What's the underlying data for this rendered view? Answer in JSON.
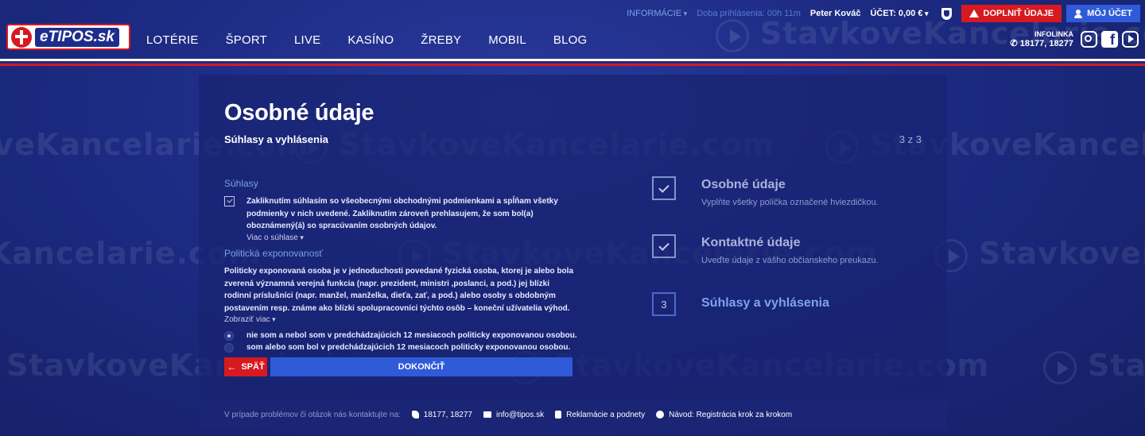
{
  "watermark": {
    "text": "StavkoveKancelarie.com"
  },
  "header": {
    "logo_text": "eTIPOS.sk",
    "nav": [
      "LOTÉRIE",
      "ŠPORT",
      "LIVE",
      "KASÍNO",
      "ŽREBY",
      "MOBIL",
      "BLOG"
    ],
    "info_label": "INFORMÁCIE",
    "login_time": "Doba prihlásenia: 00h 11m",
    "user_name": "Peter Kováč",
    "account_balance": "ÚČET: 0,00 €",
    "fill_button": "DOPLNIŤ ÚDAJE",
    "my_account_button": "MÔJ ÚČET",
    "infolinka_label": "INFOLINKA",
    "infolinka_number": "18177, 18277",
    "socials": [
      "instagram-icon",
      "facebook-icon",
      "youtube-icon"
    ],
    "stripe_colors": [
      "#ffffff",
      "#1c2a82",
      "#d71920"
    ]
  },
  "form": {
    "title": "Osobné údaje",
    "subtitle": "Súhlasy a vyhlásenia",
    "step_counter": "3 z 3",
    "consents_heading": "Súhlasy",
    "consent_text": "Zakliknutím súhlasím so všeobecnými obchodnými podmienkami a spĺňam všetky podmienky v nich uvedené. Zakliknutím zároveň prehlasujem, že som bol(a) oboznámený(á) so spracúvaním osobných údajov.",
    "consent_more": "Viac o súhlase",
    "pep_heading": "Politická exponovanosť",
    "pep_text": "Politicky exponovaná osoba je v jednoduchosti povedané fyzická osoba, ktorej je alebo bola zverená významná verejná funkcia (napr. prezident, ministri ,poslanci, a pod.) jej blízki rodinní príslušníci (napr. manžel, manželka, dieťa, zať, a pod.) alebo osoby s obdobným postavením resp. známe ako blízki spolupracovníci týchto osôb – koneční užívatelia výhod.",
    "pep_more": "Zobraziť viac",
    "pep_options": [
      "nie som a nebol som v predchádzajúcich 12 mesiacoch politicky exponovanou osobou.",
      "som alebo som bol v predchádzajúcich 12 mesiacoch politicky exponovanou osobou."
    ],
    "back_button": "SPÄŤ",
    "finish_button": "DOKONČIŤ"
  },
  "steps": [
    {
      "title": "Osobné údaje",
      "desc": "Vyplňte všetky políčka označené hviezdičkou.",
      "state": "done"
    },
    {
      "title": "Kontaktné údaje",
      "desc": "Uveďte údaje z vášho občianskeho preukazu.",
      "state": "done"
    },
    {
      "title": "Súhlasy a vyhlásenia",
      "number": "3",
      "state": "active"
    }
  ],
  "footer": {
    "lead": "V prípade problémov či otázok nás kontaktujte na:",
    "phone": "18177, 18277",
    "email": "info@tipos.sk",
    "complaints": "Reklamácie a podnety",
    "guide": "Návod: Registrácia krok za krokom"
  },
  "colors": {
    "accent_red": "#d71920",
    "accent_blue": "#2f5bd8",
    "bg": "#1c2a82"
  }
}
